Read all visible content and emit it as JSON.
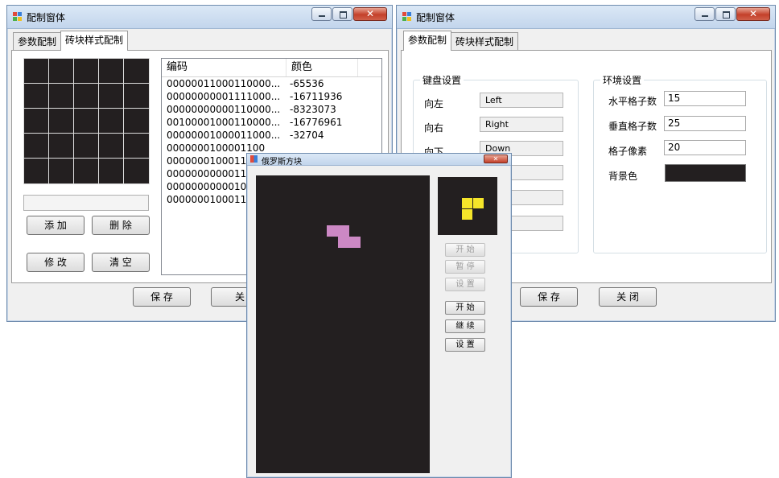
{
  "left_window": {
    "title": "配制窗体",
    "tabs": [
      {
        "label": "参数配制"
      },
      {
        "label": "砖块样式配制"
      }
    ],
    "list_headers": [
      "编码",
      "颜色"
    ],
    "rows": [
      {
        "code": "00000011000110000...",
        "color": "-65536"
      },
      {
        "code": "00000000001111000...",
        "color": "-16711936"
      },
      {
        "code": "00000000000110000...",
        "color": "-8323073"
      },
      {
        "code": "00100001000110000...",
        "color": "-16776961"
      },
      {
        "code": "00000001000011000...",
        "color": "-32704"
      },
      {
        "code": "0000000100001100",
        "color": ""
      },
      {
        "code": "0000000100011",
        "color": ""
      },
      {
        "code": "0000000000011",
        "color": ""
      },
      {
        "code": "0000000000010",
        "color": ""
      },
      {
        "code": "0000000100011",
        "color": ""
      }
    ],
    "buttons": {
      "add": "添 加",
      "delete": "删 除",
      "modify": "修 改",
      "clear": "清 空",
      "save": "保 存",
      "close": "关"
    }
  },
  "right_window": {
    "title": "配制窗体",
    "tabs": [
      {
        "label": "参数配制"
      },
      {
        "label": "砖块样式配制"
      }
    ],
    "keyboard_group": "键盘设置",
    "keys": [
      {
        "label": "向左",
        "value": "Left"
      },
      {
        "label": "向右",
        "value": "Right"
      },
      {
        "label": "向下",
        "value": "Down"
      }
    ],
    "env_group": "环境设置",
    "env": {
      "h_label": "水平格子数",
      "h_value": "15",
      "v_label": "垂直格子数",
      "v_value": "25",
      "px_label": "格子像素",
      "px_value": "20",
      "bg_label": "背景色",
      "bg_color": "#231f20"
    },
    "buttons": {
      "save": "保 存",
      "close": "关 闭"
    }
  },
  "game_window": {
    "title": "俄罗斯方块",
    "disabled_buttons": [
      "开 始",
      "暂 停",
      "设 置"
    ],
    "buttons": [
      "开 始",
      "继 续",
      "设 置"
    ],
    "board_color": "#231f20",
    "piece_color": "#cc88c4",
    "next_piece_color": "#f5e52a"
  }
}
